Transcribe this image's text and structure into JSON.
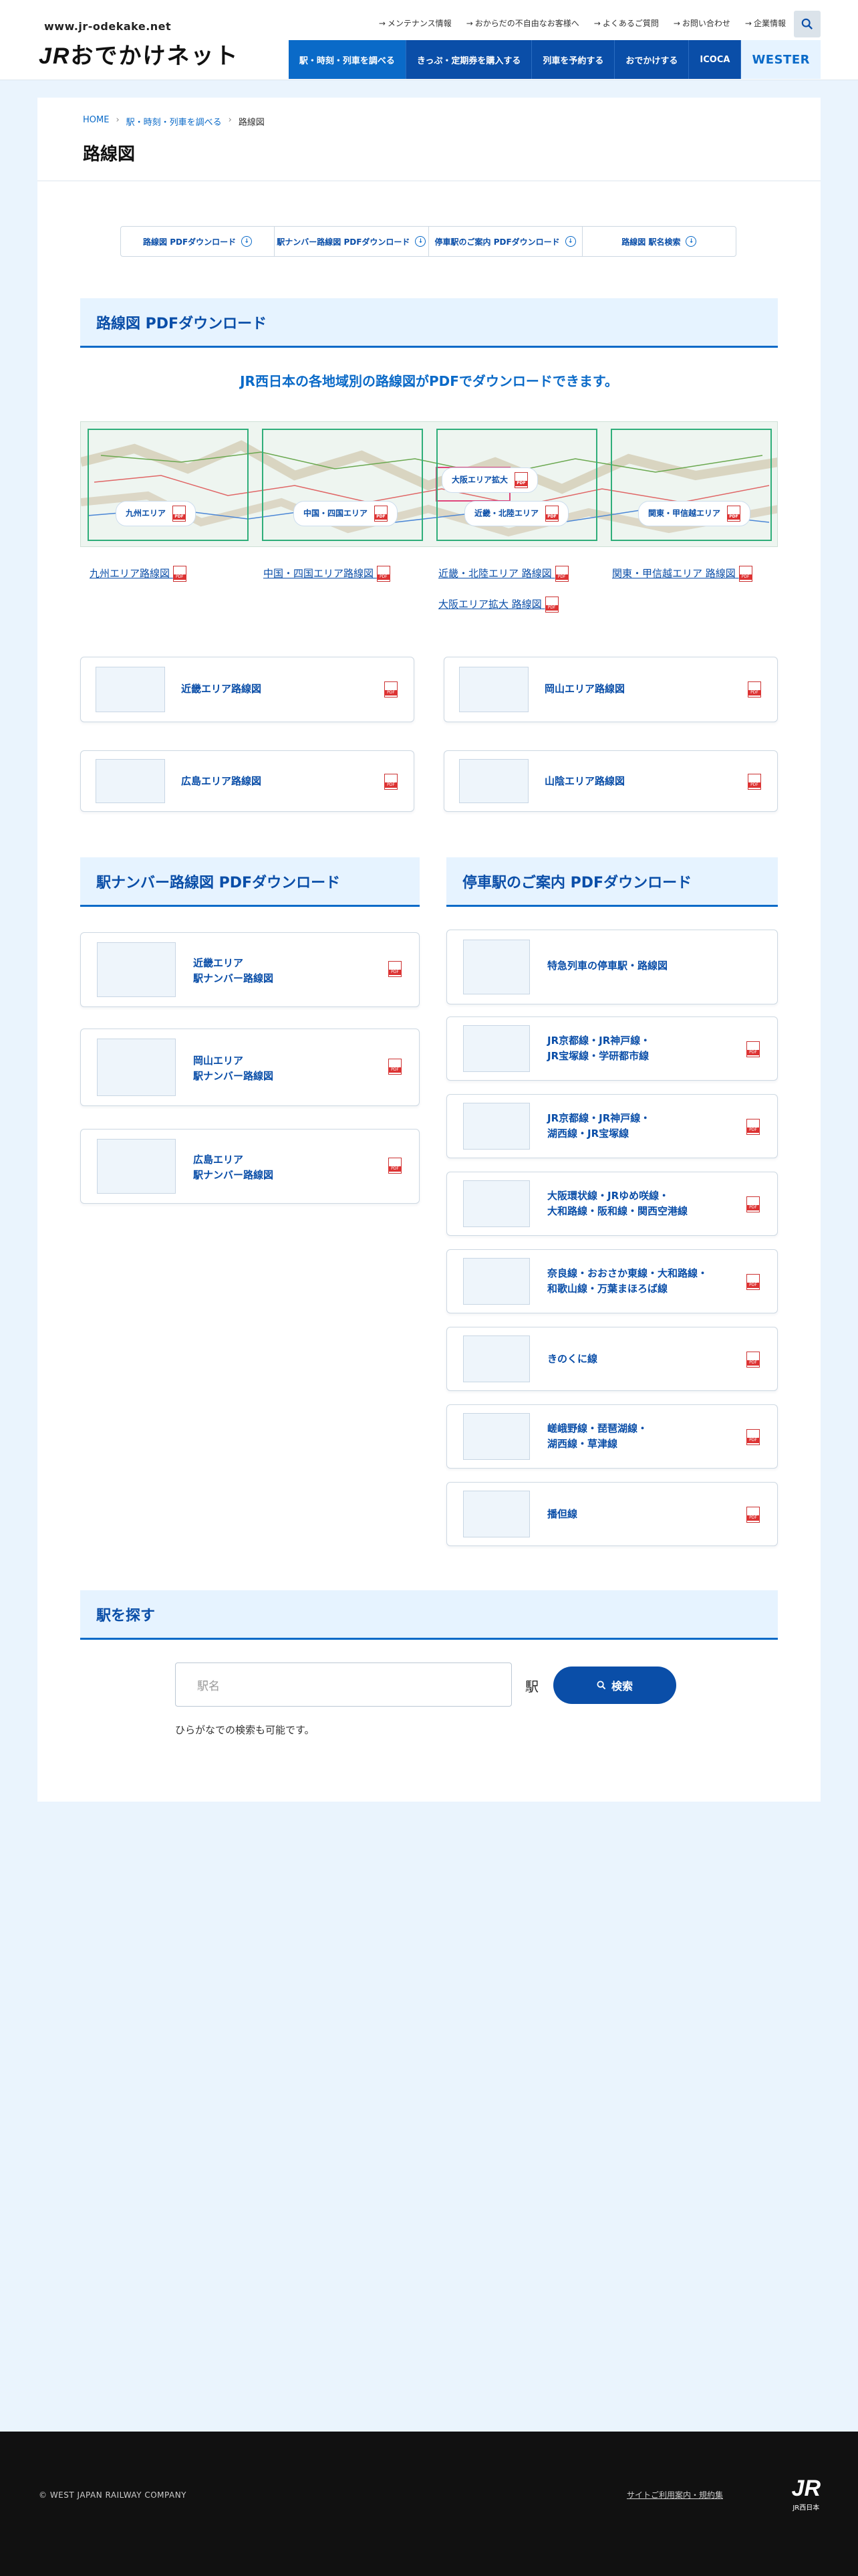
{
  "header": {
    "url": "www.jr-odekake.net",
    "logo_jr": "JR",
    "logo_text": "おでかけネット",
    "top_links": [
      "メンテナンス情報",
      "おからだの不自由なお客様へ",
      "よくあるご質問",
      "お問い合わせ",
      "企業情報"
    ],
    "nav": [
      "駅・時刻・列車を調べる",
      "きっぷ・定期券を購入する",
      "列車を予約する",
      "おでかけする",
      "ICOCA",
      "WESTER"
    ]
  },
  "breadcrumb": [
    "HOME",
    "駅・時刻・列車を調べる",
    "路線図"
  ],
  "page_title": "路線図",
  "anchors": [
    "路線図 PDFダウンロード",
    "駅ナンバー路線図 PDFダウンロード",
    "停車駅のご案内 PDFダウンロード",
    "路線図 駅名検索"
  ],
  "sec_route": {
    "title": "路線図 PDFダウンロード",
    "lead": "JR西日本の各地域別の路線図がPDFでダウンロードできます。",
    "map_labels": [
      "九州エリア",
      "中国・四国エリア",
      "大阪エリア拡大",
      "近畿・北陸エリア",
      "関東・甲信越エリア"
    ],
    "links": [
      "九州エリア路線図",
      "中国・四国エリア路線図",
      "近畿・北陸エリア 路線図",
      "関東・甲信越エリア 路線図",
      "大阪エリア拡大 路線図"
    ],
    "cards": [
      "近畿エリア路線図",
      "岡山エリア路線図",
      "広島エリア路線図",
      "山陰エリア路線図"
    ]
  },
  "sec_number": {
    "title": "駅ナンバー路線図 PDFダウンロード",
    "cards": [
      [
        "近畿エリア",
        "駅ナンバー路線図"
      ],
      [
        "岡山エリア",
        "駅ナンバー路線図"
      ],
      [
        "広島エリア",
        "駅ナンバー路線図"
      ]
    ]
  },
  "sec_stop": {
    "title": "停車駅のご案内 PDFダウンロード",
    "cards": [
      [
        "特急列車の停車駅・路線図",
        ""
      ],
      [
        "JR京都線・JR神戸線・",
        "JR宝塚線・学研都市線"
      ],
      [
        "JR京都線・JR神戸線・",
        "湖西線・JR宝塚線"
      ],
      [
        "大阪環状線・JRゆめ咲線・",
        "大和路線・阪和線・関西空港線"
      ],
      [
        "奈良線・おおさか東線・大和路線・",
        "和歌山線・万葉まほろば線"
      ],
      [
        "きのくに線",
        ""
      ],
      [
        "嵯峨野線・琵琶湖線・",
        "湖西線・草津線"
      ],
      [
        "播但線",
        ""
      ]
    ]
  },
  "sec_search": {
    "title": "駅を探す",
    "placeholder": "駅名",
    "suffix": "駅",
    "button": "検索",
    "note": "ひらがなでの検索も可能です。"
  },
  "footer": {
    "copyright": "© WEST JAPAN RAILWAY COMPANY",
    "link": "サイトご利用案内・規約集",
    "mark_big": "JR",
    "mark_small": "JR西日本"
  },
  "colors": {
    "brand": "#0a4ea8",
    "accent": "#0a6ac8",
    "map_green": "#2fae7a",
    "bg": "#eaf4fd"
  }
}
